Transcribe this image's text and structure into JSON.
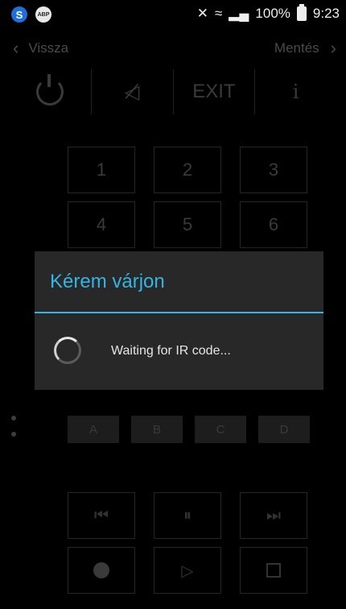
{
  "status_bar": {
    "left_icons": [
      "s-icon",
      "abp-icon"
    ],
    "abp_text": "ABP",
    "s_text": "S",
    "battery_percent": "100%",
    "time": "9:23"
  },
  "nav": {
    "back_label": "Vissza",
    "save_label": "Mentés"
  },
  "remote": {
    "top_row": {
      "exit_label": "EXIT",
      "info_label": "i"
    },
    "numpad": [
      "1",
      "2",
      "3",
      "4",
      "5",
      "6"
    ],
    "abcd": [
      "A",
      "B",
      "C",
      "D"
    ]
  },
  "dialog": {
    "title": "Kérem várjon",
    "message": "Waiting for IR code..."
  },
  "colors": {
    "accent": "#33b5e5",
    "dialog_bg": "#282828",
    "background": "#000000"
  }
}
